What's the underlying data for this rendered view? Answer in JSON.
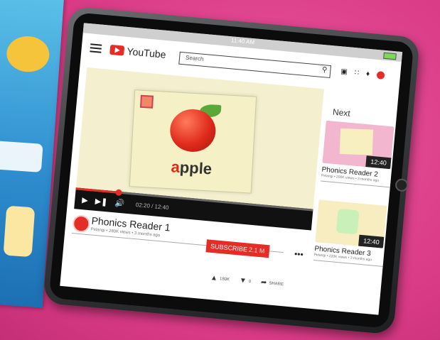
{
  "status": {
    "time": "11:40 AM"
  },
  "header": {
    "logo_text": "YouTube",
    "search_placeholder": "Search",
    "icons": [
      "video-camera-icon",
      "apps-grid-icon",
      "bell-icon",
      "channel-avatar-icon"
    ]
  },
  "player": {
    "thumbnail_word_prefix": "a",
    "thumbnail_word_rest": "pple",
    "time_text": "02:20 / 12:40",
    "progress_fraction": 0.18
  },
  "video": {
    "title": "Phonics Reader 1",
    "meta": "Pelangi • 280K views • 3 months ago",
    "subscribe_label": "SUBSCRIBE",
    "subscriber_count": "2.1 M",
    "likes": "180K",
    "dislikes": "0",
    "share_label": "SHARE"
  },
  "next": {
    "heading": "Next",
    "items": [
      {
        "title": "Phonics Reader 2",
        "meta": "Pelangi • 200K views • 3 months ago",
        "duration": "12:40"
      },
      {
        "title": "Phonics Reader 3",
        "meta": "Pelangi • 220K views • 3 months ago",
        "duration": "12:40"
      }
    ]
  },
  "colors": {
    "brand": "#e52d27",
    "background": "#d93a86"
  }
}
